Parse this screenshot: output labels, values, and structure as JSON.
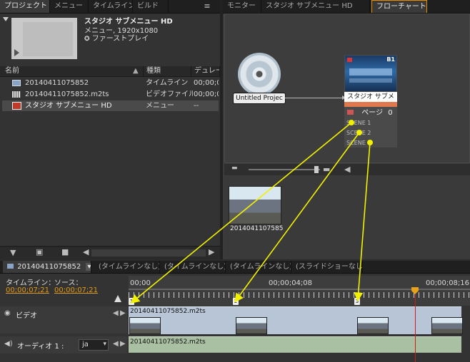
{
  "project_panel": {
    "tabs": [
      "プロジェクト",
      "メニュー",
      "タイムライン",
      "ビルド"
    ],
    "tab_close": "×",
    "menu_label": "≡",
    "preview": {
      "title": "スタジオ サブメニュー HD",
      "subtitle": "メニュー, 1920x1080",
      "first_play": "ファーストプレイ"
    },
    "columns": [
      "名前",
      "種類",
      "デュレー"
    ],
    "rows": [
      {
        "name": "20140411075852",
        "type": "タイムライン",
        "dur": "00;00;0"
      },
      {
        "name": "20140411075852.m2ts",
        "type": "ビデオファイル",
        "dur": "00;00;0"
      },
      {
        "name": "スタジオ サブメニュー HD",
        "type": "メニュー",
        "dur": "--"
      }
    ]
  },
  "right_panel": {
    "tabs": [
      "モニター",
      "スタジオ サブメニュー HD",
      "フローチャート"
    ],
    "tab_close": "×",
    "disc_label": "Untitled Projec",
    "menu_node": {
      "title": "スタジオ サブメ",
      "page": "ページ",
      "page_number": "0",
      "badge": "B1",
      "scenes": [
        "SCENE 1",
        "SCENE 2",
        "SCENE 3"
      ]
    },
    "bin_item": "2014041107585"
  },
  "timeline": {
    "tabs": [
      "20140411075852",
      "(タイムラインなし)",
      "(タイムラインなし)",
      "(タイムラインなし)",
      "(スライドショーなし)"
    ],
    "dropdown": "▾",
    "timeline_label": "タイムライン：",
    "source_label": "ソース：",
    "timeline_value": "00;00;07;21",
    "source_value": "00;00;07;21",
    "ruler": [
      "00;00",
      "00;00;04;08",
      "00;00;08;16"
    ],
    "chapter_marks": [
      "1",
      "2",
      "3"
    ],
    "video_track": {
      "label": "ビデオ",
      "clip": "20140411075852.m2ts"
    },
    "audio_track": {
      "label": "オーディオ 1 :",
      "lang": "ja",
      "clip": "20140411075852.m2ts"
    }
  }
}
